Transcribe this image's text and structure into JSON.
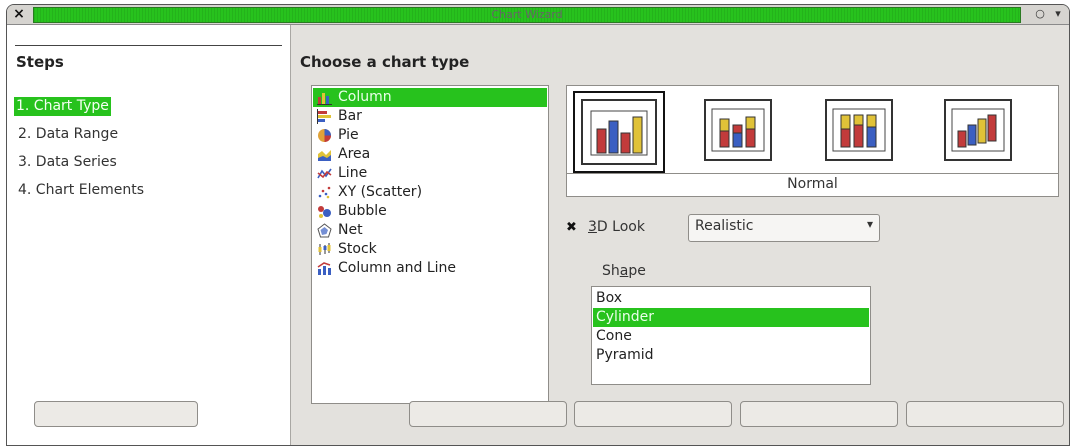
{
  "window": {
    "title": "Chart Wizard",
    "close_glyph": "×",
    "minimize_glyph": "○",
    "menu_glyph": "▾",
    "accent_color": "#27c21d"
  },
  "steps": {
    "title": "Steps",
    "items": [
      "1. Chart Type",
      "2. Data Range",
      "3. Data Series",
      "4. Chart Elements"
    ],
    "active_index": 0
  },
  "chart_type": {
    "heading": "Choose a chart type",
    "types": [
      {
        "label": "Column",
        "icon": "column-chart-icon"
      },
      {
        "label": "Bar",
        "icon": "bar-chart-icon"
      },
      {
        "label": "Pie",
        "icon": "pie-chart-icon"
      },
      {
        "label": "Area",
        "icon": "area-chart-icon"
      },
      {
        "label": "Line",
        "icon": "line-chart-icon"
      },
      {
        "label": "XY (Scatter)",
        "icon": "scatter-chart-icon"
      },
      {
        "label": "Bubble",
        "icon": "bubble-chart-icon"
      },
      {
        "label": "Net",
        "icon": "net-chart-icon"
      },
      {
        "label": "Stock",
        "icon": "stock-chart-icon"
      },
      {
        "label": "Column and Line",
        "icon": "column-line-chart-icon"
      }
    ],
    "selected_index": 0
  },
  "variants": {
    "caption": "Normal",
    "items": [
      "normal-column-variant-icon",
      "stacked-column-variant-icon",
      "percent-stacked-column-variant-icon",
      "deep-column-variant-icon"
    ],
    "selected_index": 0
  },
  "options": {
    "look_checked": true,
    "look_label_prefix": "",
    "look_label_access": "3",
    "look_label_rest": "D Look",
    "look_value": "Realistic",
    "shape_label_pre": "Sh",
    "shape_label_access": "a",
    "shape_label_post": "pe",
    "shapes": [
      "Box",
      "Cylinder",
      "Cone",
      "Pyramid"
    ],
    "selected_shape_index": 1
  }
}
